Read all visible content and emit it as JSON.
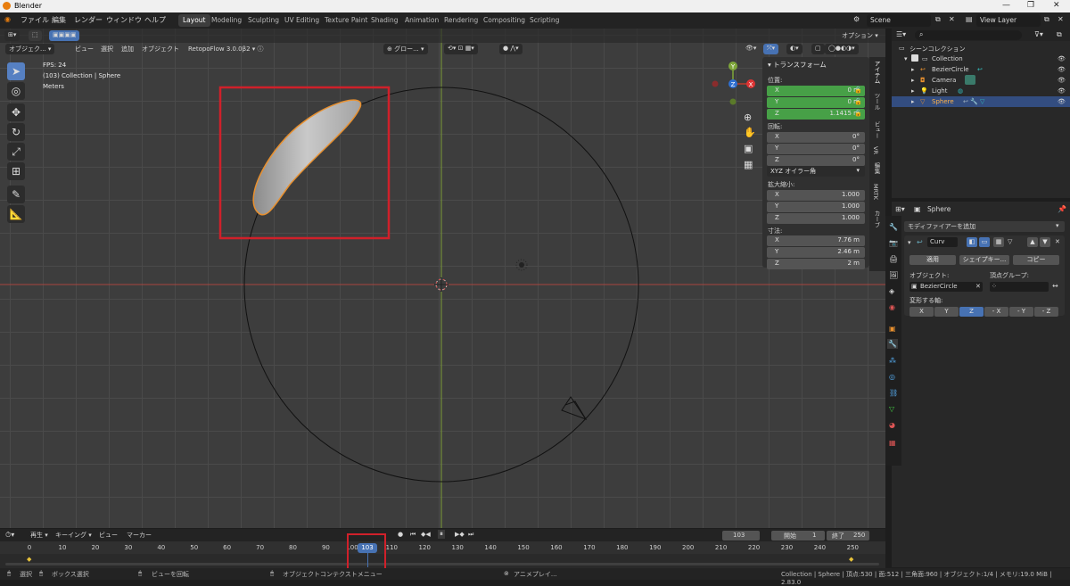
{
  "window": {
    "title": "Blender",
    "controls": [
      "—",
      "❐",
      "✕"
    ]
  },
  "menubar": {
    "items": [
      "ファイル",
      "編集",
      "レンダー",
      "ウィンドウ",
      "ヘルプ"
    ]
  },
  "workspaces": [
    "Layout",
    "Modeling",
    "Sculpting",
    "UV Editing",
    "Texture Paint",
    "Shading",
    "Animation",
    "Rendering",
    "Compositing",
    "Scripting"
  ],
  "active_workspace": "Layout",
  "scene": {
    "name": "Scene",
    "view_layer": "View Layer"
  },
  "viewport_header": {
    "mode": "オブジェク...",
    "menus": [
      "ビュー",
      "選択",
      "追加",
      "オブジェクト"
    ],
    "addon": "RetopoFlow 3.0.0β2",
    "transform_orientation": "グロー...",
    "options_label": "オプション"
  },
  "overlay_text": {
    "fps": "FPS: 24",
    "collection": "(103) Collection | Sphere",
    "units": "Meters"
  },
  "gizmo": {
    "x": "X",
    "y": "Y",
    "z": "Z"
  },
  "transform_panel": {
    "title": "トランスフォーム",
    "location_label": "位置:",
    "location": [
      {
        "axis": "X",
        "value": "0 m"
      },
      {
        "axis": "Y",
        "value": "0 m"
      },
      {
        "axis": "Z",
        "value": "1.1415 m"
      }
    ],
    "rotation_label": "回転:",
    "rotation": [
      {
        "axis": "X",
        "value": "0°"
      },
      {
        "axis": "Y",
        "value": "0°"
      },
      {
        "axis": "Z",
        "value": "0°"
      }
    ],
    "rotation_mode": "XYZ オイラー角",
    "scale_label": "拡大縮小:",
    "scale": [
      {
        "axis": "X",
        "value": "1.000"
      },
      {
        "axis": "Y",
        "value": "1.000"
      },
      {
        "axis": "Z",
        "value": "1.000"
      }
    ],
    "dimensions_label": "寸法:",
    "dimensions": [
      {
        "axis": "X",
        "value": "7.76 m"
      },
      {
        "axis": "Y",
        "value": "2.46 m"
      },
      {
        "axis": "Z",
        "value": "2 m"
      }
    ]
  },
  "side_tabs": [
    "アイテム",
    "ツール",
    "ビュー",
    "VR",
    "編集",
    "MRTK",
    "カーブ"
  ],
  "outliner": {
    "root": "シーンコレクション",
    "collection": "Collection",
    "objects": [
      "BezierCircle",
      "Camera",
      "Light",
      "Sphere"
    ],
    "selected": "Sphere"
  },
  "properties": {
    "object_name": "Sphere",
    "add_modifier": "モディファイアーを追加",
    "modifier_name": "Curv",
    "apply": "適用",
    "shape_key": "シェイプキー...",
    "copy": "コピー",
    "object_label": "オブジェクト:",
    "object_value": "BezierCircle",
    "vertex_group_label": "頂点グループ:",
    "deform_axis_label": "変形する軸:",
    "axes": [
      "X",
      "Y",
      "Z",
      "- X",
      "- Y",
      "- Z"
    ],
    "active_axis": "Z"
  },
  "timeline": {
    "menus": [
      "再生",
      "キーイング",
      "ビュー",
      "マーカー"
    ],
    "current_frame": "103",
    "start_label": "開始",
    "start": "1",
    "end_label": "終了",
    "end": "250",
    "ticks": [
      "0",
      "10",
      "20",
      "30",
      "40",
      "50",
      "60",
      "70",
      "80",
      "90",
      "100",
      "110",
      "120",
      "130",
      "140",
      "150",
      "160",
      "170",
      "180",
      "190",
      "200",
      "210",
      "220",
      "230",
      "240",
      "250"
    ]
  },
  "status_bar": {
    "select": "選択",
    "box_select": "ボックス選択",
    "rotate_view": "ビューを回転",
    "context_menu": "オブジェクトコンテクストメニュー",
    "anim_play": "アニメプレイ...",
    "stats": "Collection | Sphere | 頂点:530 | 面:512 | 三角面:960 | オブジェクト:1/4 | メモリ:19.0 MiB | 2.83.0"
  },
  "colors": {
    "accent": "#4772b3",
    "selection_outline": "#e8902f",
    "annotation": "#d0202a",
    "x_axis": "#c0392b",
    "y_axis": "#7ea63a"
  }
}
